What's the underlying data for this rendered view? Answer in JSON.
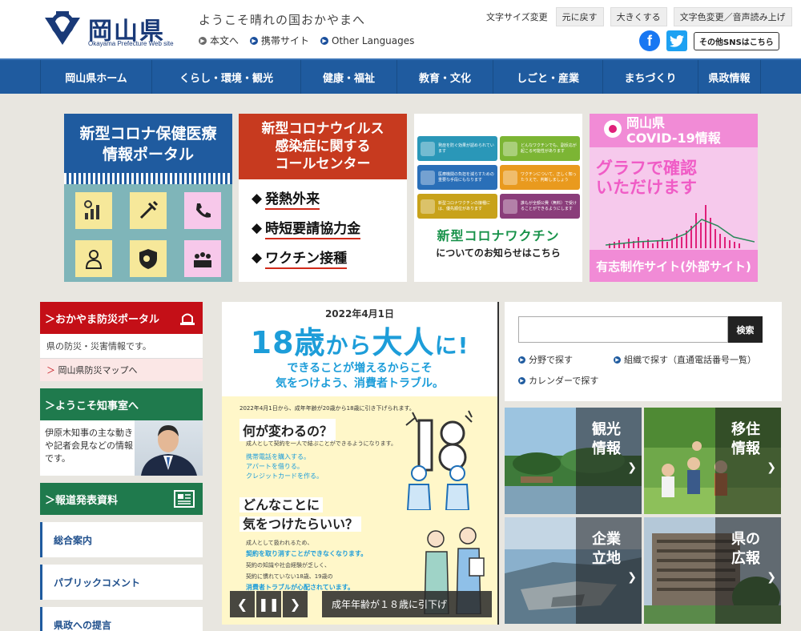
{
  "header": {
    "logo_title": "岡山県",
    "logo_sub": "Okayama Prefecture Web site",
    "tagline": "ようこそ晴れの国おかやまへ",
    "links": [
      "本文へ",
      "携帯サイト",
      "Other Languages"
    ],
    "font_size_label": "文字サイズ変更",
    "font_buttons": [
      "元に戻す",
      "大きくする"
    ],
    "color_button": "文字色変更／音声読み上げ",
    "sns_button": "その他SNSはこちら"
  },
  "nav": {
    "items": [
      "岡山県ホーム",
      "くらし・環境・観光",
      "健康・福祉",
      "教育・文化",
      "しごと・産業",
      "まちづくり",
      "県政情報"
    ]
  },
  "banners": {
    "b1": {
      "title_line1": "新型コロナ保健医療",
      "title_line2": "情報ポータル"
    },
    "b2": {
      "title_line1": "新型コロナウイルス",
      "title_line2": "感染症に関する",
      "title_line3": "コールセンター",
      "items": [
        "発熱外来",
        "時短要請協力金",
        "ワクチン接種"
      ]
    },
    "b3": {
      "cells": [
        "発症を防ぐ効果が認められています",
        "どんなワクチンでも、副反応が起こる可能性があります",
        "医療機関の負担を減らすための重要な手段にもなります",
        "ワクチンについて、正しく知ったうえで、判断しましょう",
        "新型コロナワクチンの接種には、優先順位があります",
        "誰もが全額公費（無料）で受けることができるようにします"
      ],
      "title": "新型コロナワクチン",
      "subtitle": "についてのお知らせはこちら"
    },
    "b4": {
      "title_line1": "岡山県",
      "title_line2": "COVID-19情報",
      "text_line1": "グラフで確認",
      "text_line2": "いただけます",
      "footer": "有志制作サイト(外部サイト)"
    }
  },
  "left": {
    "bosai_title": "おかやま防災ポータル",
    "bosai_body": "県の防災・災害情報です。",
    "bosai_link": "岡山県防災マップへ",
    "chiji_title": "ようこそ知事室へ",
    "chiji_text": "伊原木知事の主な動きや記者会見などの情報です。",
    "houdou_title": "報道発表資料",
    "links": [
      "総合案内",
      "パブリックコメント",
      "県政への提言"
    ]
  },
  "slide": {
    "date": "2022年4月1日",
    "headline_a": "18歳",
    "headline_b": "から",
    "headline_c": "大人",
    "headline_d": "に!",
    "line1": "できることが増えるからこそ",
    "line2": "気をつけよう、消費者トラブル。",
    "note": "2022年4月1日から、成年年齢が20歳から18歳に引き下げられます。",
    "q1": "何が変わるの？",
    "q1_body": "成人として契約を一人で結ぶことができるようになります。",
    "q1_list": [
      "携帯電話を購入する。",
      "アパートを借りる。",
      "クレジットカードを作る。"
    ],
    "q2_line1": "どんなことに",
    "q2_line2": "気をつけたらいい？",
    "q2_body1": "成人として扱われるため、",
    "q2_body2": "契約を取り消すことができなくなります。",
    "q2_body3": "契約の知識や社会経験が乏しく、",
    "q2_body4": "契約に慣れていない18歳、19歳の",
    "q2_body5": "消費者トラブルが心配されています。",
    "caption": "成年年齢が１８歳に引下げ",
    "prev": "❮",
    "pause": "❚❚",
    "next": "❯"
  },
  "search": {
    "placeholder": "",
    "button": "検索",
    "links": [
      "分野で探す",
      "組織で探す（直通電話番号一覧）",
      "カレンダーで探す"
    ]
  },
  "tiles": [
    {
      "line1": "観光",
      "line2": "情報"
    },
    {
      "line1": "移住",
      "line2": "情報"
    },
    {
      "line1": "企業",
      "line2": "立地"
    },
    {
      "line1": "県の",
      "line2": "広報"
    }
  ]
}
